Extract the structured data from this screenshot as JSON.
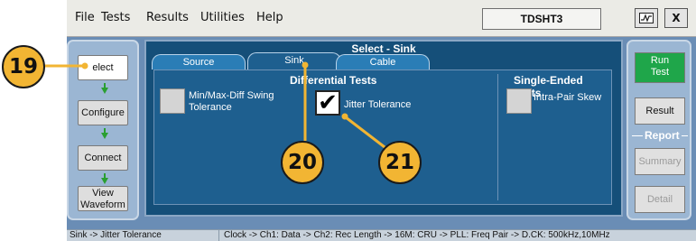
{
  "menu": {
    "items": [
      "File",
      "Tests",
      "Results",
      "Utilities",
      "Help"
    ]
  },
  "title_box": "TDSHT3",
  "window_buttons": {
    "restore_icon": "scope-icon",
    "close": "X"
  },
  "nav": {
    "select": "elect",
    "configure": "Configure",
    "connect": "Connect",
    "view_line1": "View",
    "view_line2": "Waveform"
  },
  "main": {
    "title": "Select - Sink",
    "tabs": [
      {
        "label": "Source",
        "active": false
      },
      {
        "label": "Sink",
        "active": true
      },
      {
        "label": "Cable",
        "active": false
      }
    ],
    "differential_heading": "Differential Tests",
    "single_ended_heading": "Single-Ended Tests",
    "tests": {
      "minmax_line1": "Min/Max-Diff Swing",
      "minmax_line2": "Tolerance",
      "jitter": "Jitter Tolerance",
      "jitter_check": "✔",
      "intra": "Intra-Pair Skew"
    }
  },
  "right": {
    "run_line1": "Run",
    "run_line2": "Test",
    "result": "Result",
    "report_label": "Report",
    "summary": "Summary",
    "detail": "Detail"
  },
  "status": {
    "left": "Sink -> Jitter Tolerance",
    "right": "Clock -> Ch1: Data -> Ch2: Rec Length -> 16M: CRU -> PLL: Freq Pair -> D.CK: 500kHz,10MHz"
  },
  "callouts": {
    "c19": "19",
    "c20": "20",
    "c21": "21"
  },
  "colors": {
    "callout_fill": "#f2b533",
    "run_button": "#1fa64a",
    "panel_blue": "#1e5f8f",
    "nav_arrow": "#2a9f31"
  }
}
